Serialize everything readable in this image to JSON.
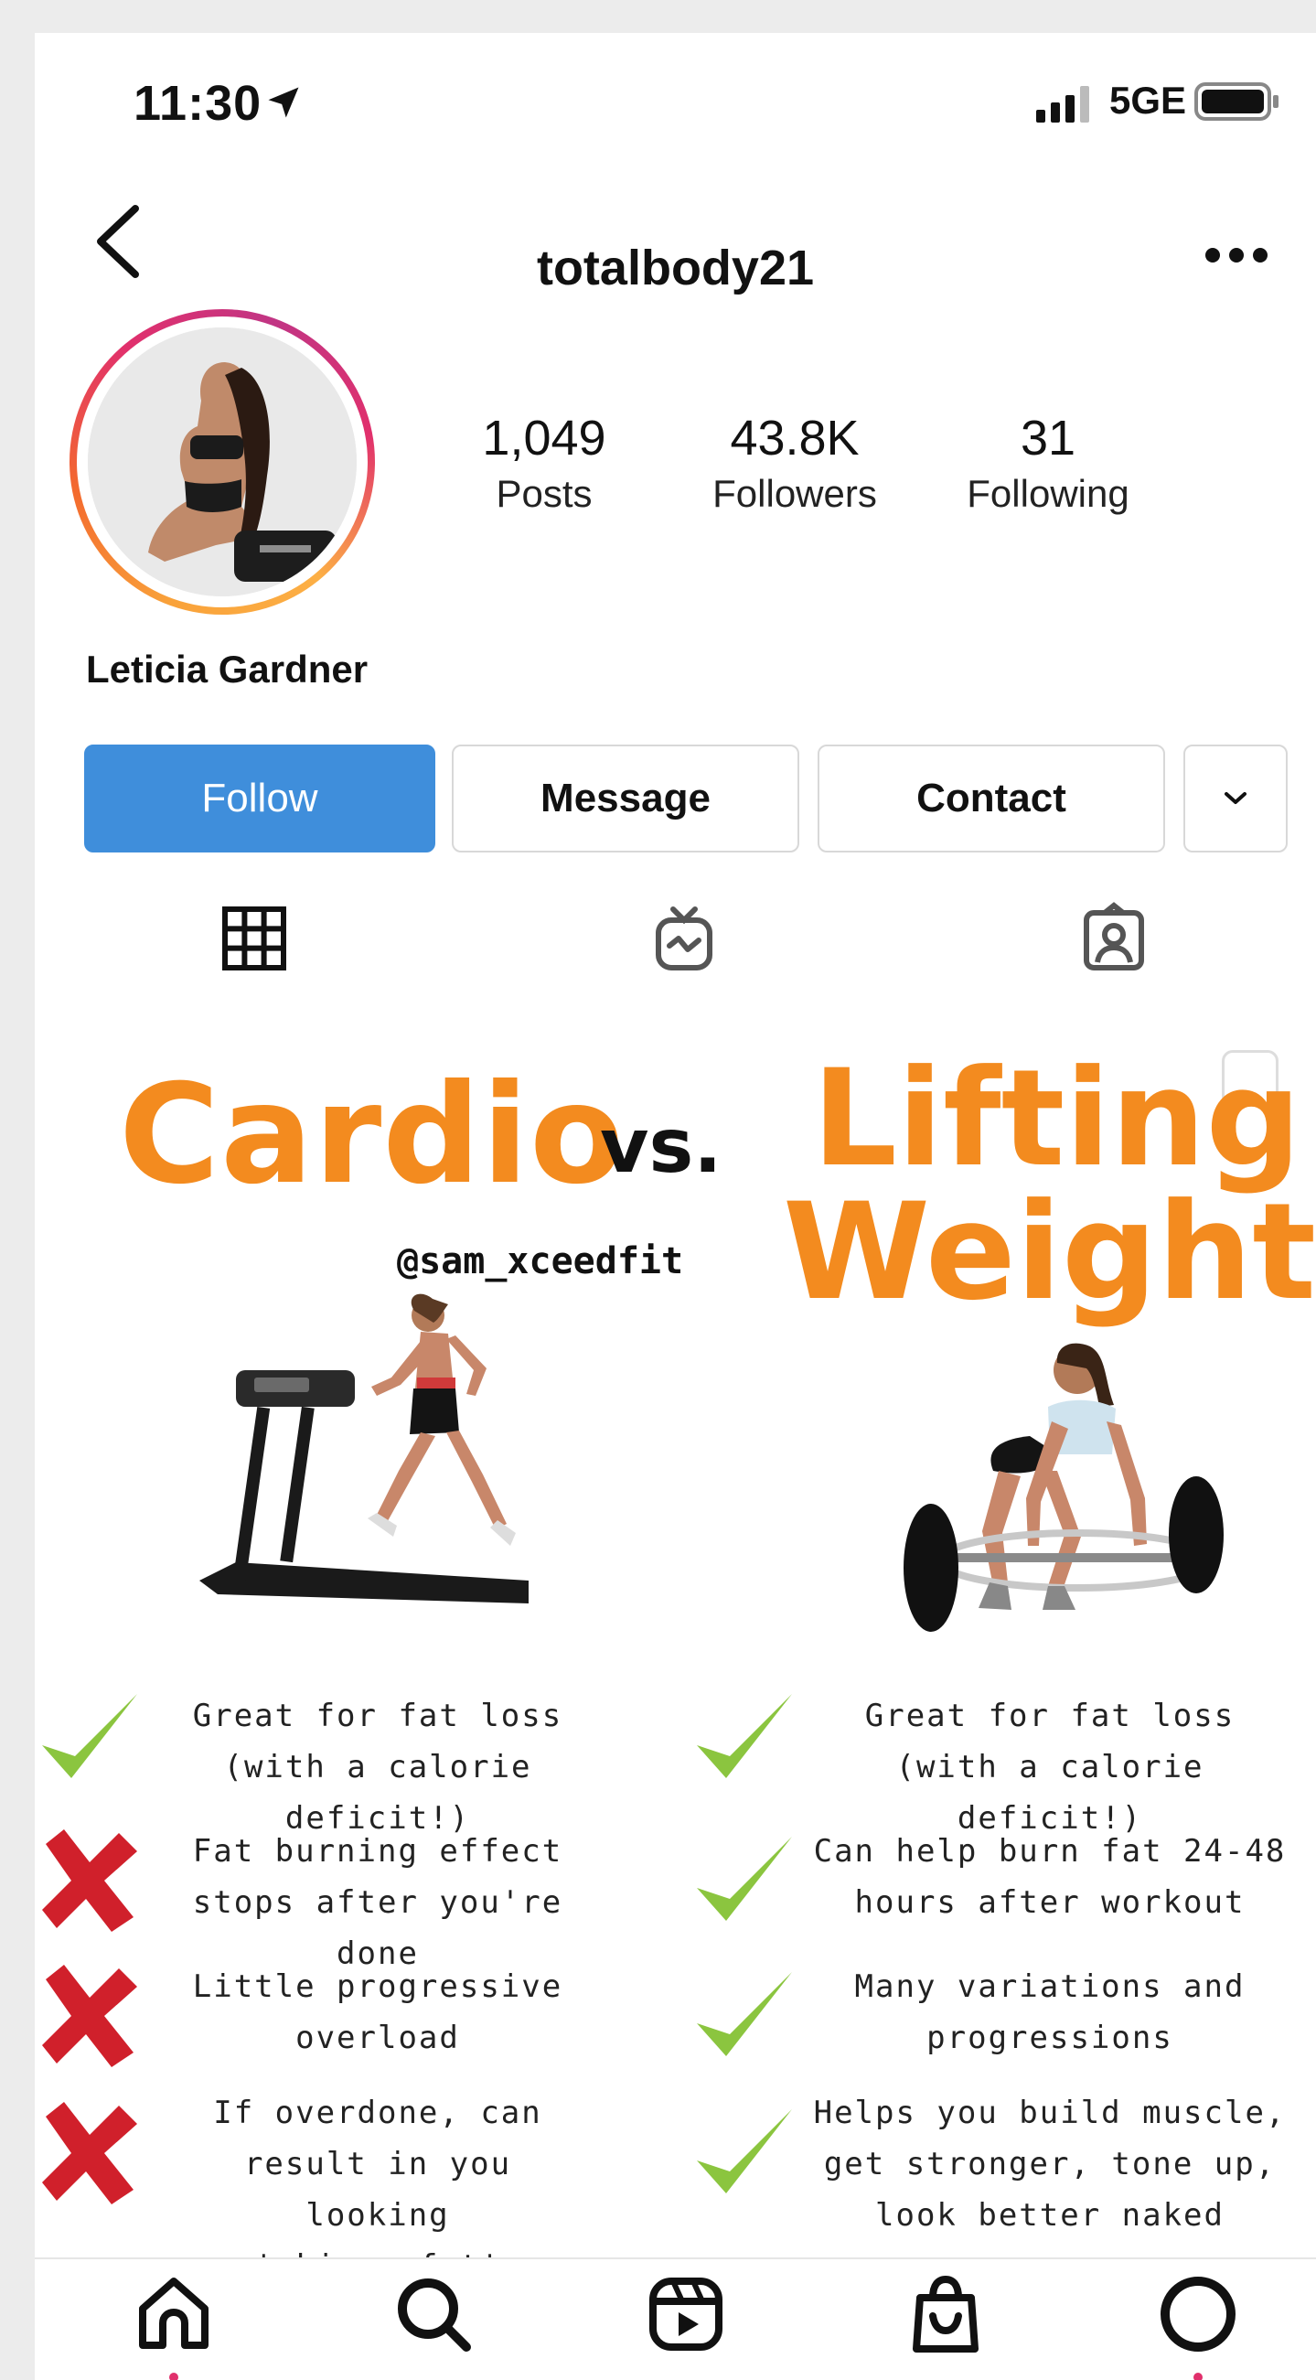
{
  "status_bar": {
    "time": "11:30",
    "network": "5GE"
  },
  "header": {
    "username": "totalbody21"
  },
  "profile": {
    "stats": [
      {
        "value": "1,049",
        "label": "Posts"
      },
      {
        "value": "43.8K",
        "label": "Followers"
      },
      {
        "value": "31",
        "label": "Following"
      }
    ],
    "full_name": "Leticia Gardner"
  },
  "actions": {
    "follow_label": "Follow",
    "message_label": "Message",
    "contact_label": "Contact"
  },
  "tabs": [
    {
      "icon": "grid-icon"
    },
    {
      "icon": "igtv-icon"
    },
    {
      "icon": "tagged-icon"
    }
  ],
  "post": {
    "title_left": "Cardio",
    "versus": "vs.",
    "title_right_line1": "Lifting",
    "title_right_line2": "Weights",
    "handle": "@sam_xceedfit",
    "cardio_points": [
      {
        "line1": "Great for fat loss",
        "line2": "(with a calorie deficit!)",
        "line3": "",
        "mark": "check"
      },
      {
        "line1": "Fat burning effect",
        "line2": "stops after you're done",
        "line3": "",
        "mark": "cross"
      },
      {
        "line1": "Little progressive",
        "line2": "overload",
        "line3": "",
        "mark": "cross"
      },
      {
        "line1": "If overdone, can",
        "line2": "result in you looking",
        "line3": "'skinny fat'",
        "mark": "cross"
      }
    ],
    "lifting_points": [
      {
        "line1": "Great for fat loss",
        "line2": "(with a calorie deficit!)",
        "line3": "",
        "mark": "check"
      },
      {
        "line1": "Can help burn fat 24-48",
        "line2": "hours after workout",
        "line3": "",
        "mark": "check"
      },
      {
        "line1": "Many variations and",
        "line2": "progressions",
        "line3": "",
        "mark": "check"
      },
      {
        "line1": "Helps you build muscle,",
        "line2": "get stronger, tone up,",
        "line3": "look better naked",
        "mark": "check"
      }
    ],
    "colors": {
      "accent": "#f38b1f",
      "check": "#8bc53f",
      "cross": "#d0202b"
    }
  },
  "bottom_nav": [
    {
      "icon": "home-icon"
    },
    {
      "icon": "search-icon"
    },
    {
      "icon": "reels-icon"
    },
    {
      "icon": "shop-icon"
    },
    {
      "icon": "profile-icon"
    }
  ],
  "colors": {
    "follow_button": "#3f8edb",
    "story_ring": "#e1306c"
  }
}
